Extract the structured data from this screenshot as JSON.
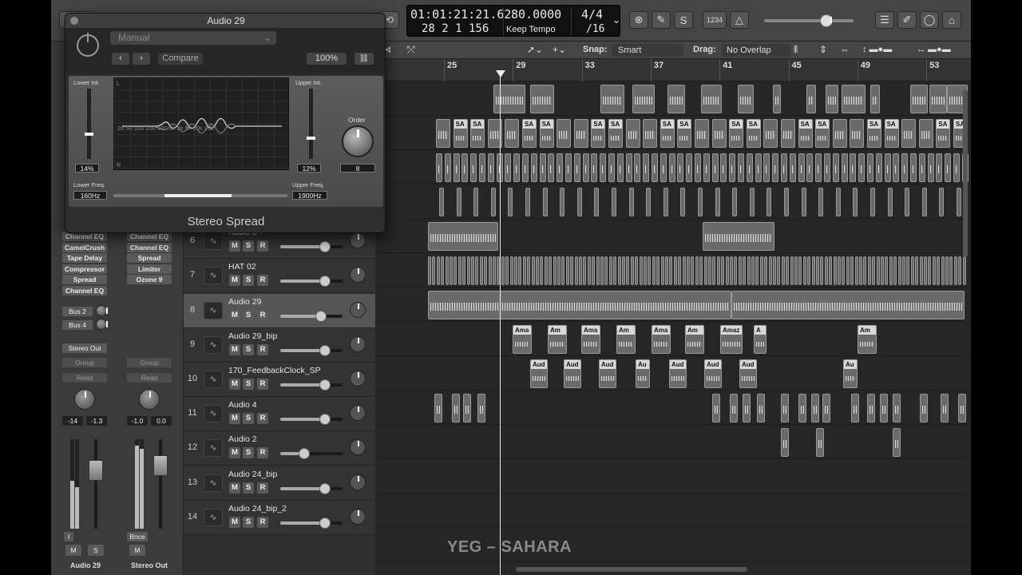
{
  "app": {
    "lcd": {
      "position": "01:01:21:21.62",
      "beats": "28  2  1  156",
      "tempo": "80.0000",
      "tempo_mode": "Keep Tempo",
      "signature": "4/4",
      "division": "/16"
    },
    "count_in": "1234"
  },
  "plugin": {
    "title": "Audio 29",
    "preset": "Manual",
    "compare": "Compare",
    "zoom": "100%",
    "lower_int_label": "Lower Int.",
    "lower_int_value": "14%",
    "upper_int_label": "Upper Int.",
    "upper_int_value": "12%",
    "order_label": "Order",
    "order_value": "8",
    "lower_freq_label": "Lower Freq.",
    "lower_freq_value": "160Hz",
    "upper_freq_label": "Upper Freq.",
    "upper_freq_value": "1900Hz",
    "freq_axis": "20      50   100  200     500   1k   2k    5k   10k  20k",
    "display_l": "L",
    "display_r": "R",
    "name": "Stereo Spread",
    "lower_int_level": 0.14,
    "upper_int_level": 0.12
  },
  "tracks_bar": {
    "snap_label": "Snap:",
    "snap_value": "Smart",
    "drag_label": "Drag:",
    "drag_value": "No Overlap"
  },
  "ruler": [
    "25",
    "29",
    "33",
    "37",
    "41",
    "45",
    "49",
    "53"
  ],
  "inspector": {
    "left_slots": [
      "Channel EQ",
      "CamelCrush",
      "Tape Delay",
      "Compressor",
      "Spread",
      "Channel EQ"
    ],
    "right_slots": [
      "Channel EQ",
      "Channel EQ",
      "Spread",
      "Limiter",
      "Ozone 9"
    ],
    "sends": [
      "Bus 2",
      "Bus 4"
    ],
    "output": "Stereo Out",
    "group": "Group",
    "automation": "Read",
    "left_vals": [
      "-14",
      "-1.3"
    ],
    "right_vals": [
      "-1.0",
      "0.0"
    ],
    "bounce": "Bnce",
    "left_name": "Audio 29",
    "right_name": "Stereo Out",
    "m": "M",
    "s": "S",
    "i": "I"
  },
  "tracks": [
    {
      "num": "",
      "name": "",
      "fader": 0.72,
      "selected": false
    },
    {
      "num": "6",
      "name": "Audio 8",
      "fader": 0.72,
      "selected": false
    },
    {
      "num": "7",
      "name": "HAT 02",
      "fader": 0.72,
      "selected": false
    },
    {
      "num": "8",
      "name": "Audio 29",
      "fader": 0.66,
      "selected": true
    },
    {
      "num": "9",
      "name": "Audio 29_bip",
      "fader": 0.72,
      "selected": false
    },
    {
      "num": "10",
      "name": "170_FeedbackClock_SP",
      "fader": 0.72,
      "selected": false
    },
    {
      "num": "11",
      "name": "Audio 4",
      "fader": 0.72,
      "selected": false
    },
    {
      "num": "12",
      "name": "Audio 2",
      "fader": 0.38,
      "selected": false
    },
    {
      "num": "13",
      "name": "Audio 24_bip",
      "fader": 0.72,
      "selected": false
    },
    {
      "num": "14",
      "name": "Audio 24_bip_2",
      "fader": 0.72,
      "selected": false
    }
  ],
  "region_labels": {
    "sa": "SA",
    "ama": "Ama",
    "am": "Am",
    "amaz": "Amaz",
    "a": "A",
    "aud": "Aud",
    "au": "Au"
  },
  "watermark": "YEG – SAHARA"
}
